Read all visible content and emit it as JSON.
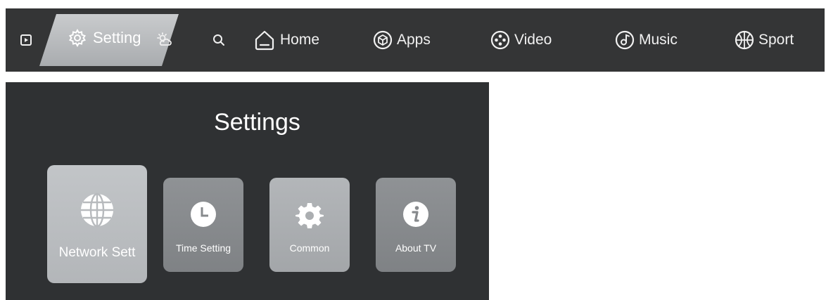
{
  "topbar": {
    "setting_label": "Setting",
    "items": [
      {
        "label": "Home"
      },
      {
        "label": "Apps"
      },
      {
        "label": "Video"
      },
      {
        "label": "Music"
      },
      {
        "label": "Sport"
      }
    ]
  },
  "settings": {
    "title": "Settings",
    "tiles": [
      {
        "label": "Network Sett",
        "icon": "globe-icon"
      },
      {
        "label": "Time Setting",
        "icon": "clock-icon"
      },
      {
        "label": "Common",
        "icon": "gear-icon"
      },
      {
        "label": "About TV",
        "icon": "info-icon"
      }
    ]
  },
  "colors": {
    "bar_background": "#343536",
    "panel_background": "#2f3133",
    "selected_tab": "#b8bbbe"
  }
}
